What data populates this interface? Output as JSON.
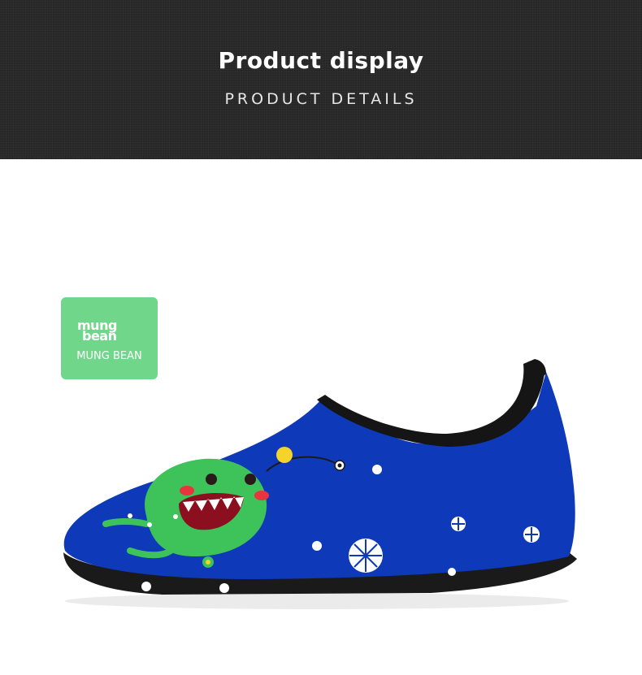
{
  "header": {
    "title": "Product display",
    "subtitle": "PRODUCT DETAILS"
  },
  "swatch": {
    "logo_line1": "mung",
    "logo_line2": "bean",
    "label": "MUNG BEAN",
    "color": "#6fd68a"
  },
  "product": {
    "image": "water-shoe",
    "upper_color": "#0e39b8",
    "graphic": "green-monster-icon"
  }
}
